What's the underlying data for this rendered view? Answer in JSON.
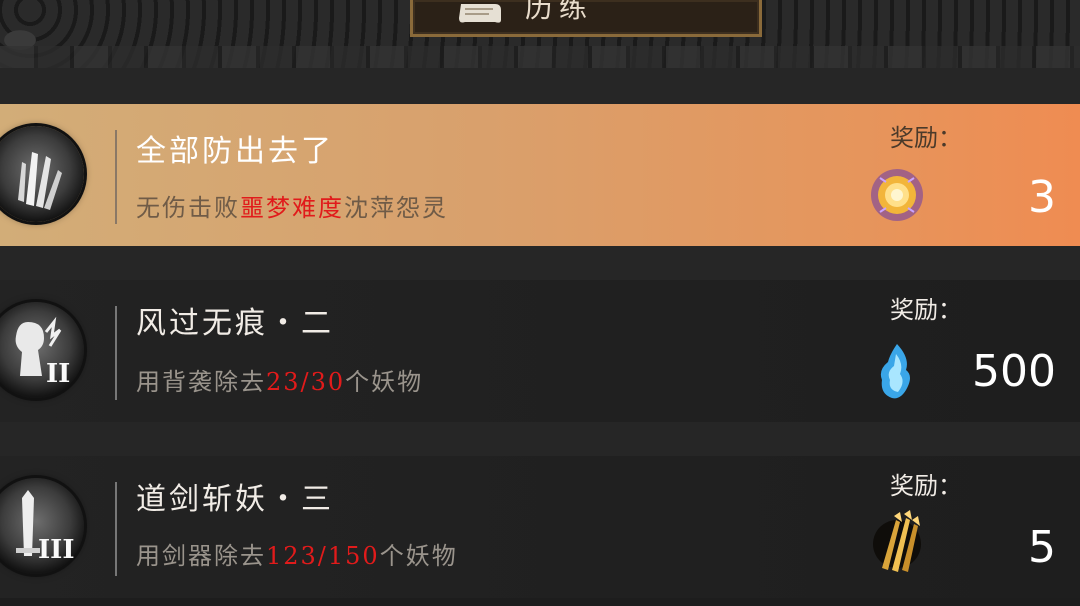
{
  "header": {
    "title": "历练"
  },
  "tasks": [
    {
      "title": "全部防出去了",
      "desc_prefix": "无伤击败",
      "desc_highlight": "噩梦难度",
      "desc_suffix": "沈萍怨灵",
      "reward_label": "奖励：",
      "reward_icon": "golden-orb-icon",
      "reward_count": "3",
      "badge_icon": "claw-badge-icon",
      "state": "completed"
    },
    {
      "title": "风过无痕・二",
      "desc_prefix": "用背袭除去",
      "desc_highlight": "23/30",
      "desc_suffix": "个妖物",
      "reward_label": "奖励：",
      "reward_icon": "blue-soul-flame-icon",
      "reward_count": "500",
      "badge_icon": "shattered-figure-badge-icon",
      "badge_numeral": "II"
    },
    {
      "title": "道剑斩妖・三",
      "desc_prefix": "用剑器除去",
      "desc_highlight": "123/150",
      "desc_suffix": "个妖物",
      "reward_label": "奖励：",
      "reward_icon": "golden-arrows-icon",
      "reward_count": "5",
      "badge_icon": "sword-badge-icon",
      "badge_numeral": "III"
    }
  ],
  "colors": {
    "highlight": "#e11b1b",
    "active_row_start": "#d2ad78",
    "active_row_end": "#ef8c52",
    "row_bg": "#212121"
  }
}
